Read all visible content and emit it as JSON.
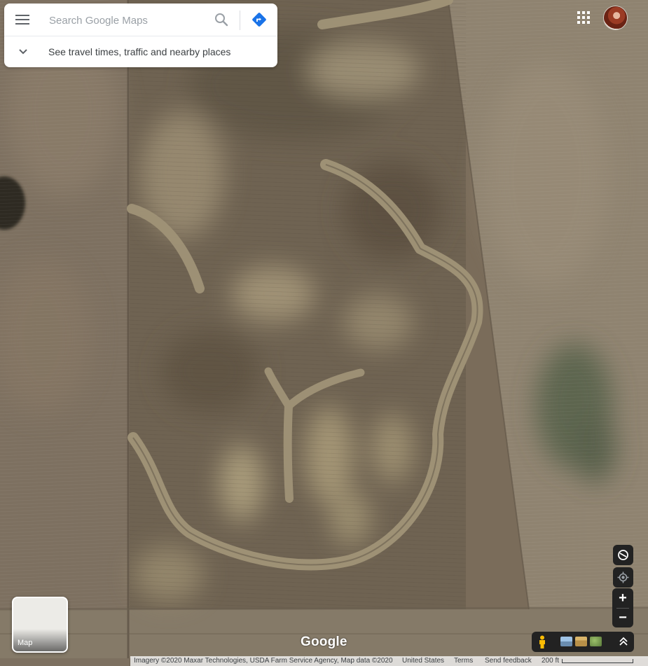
{
  "search": {
    "placeholder": "Search Google Maps"
  },
  "nearby": {
    "label": "See travel times, traffic and nearby places"
  },
  "icons": {
    "menu": "menu-icon",
    "search": "search-icon",
    "directions": "directions-icon",
    "chevron": "chevron-down-icon",
    "apps": "apps-grid-icon",
    "avatar": "account-avatar",
    "rotate": "rotate-view-icon",
    "location": "my-location-icon",
    "zoom_in": "plus-icon",
    "zoom_out": "minus-icon",
    "pegman": "street-view-pegman-icon",
    "expand": "expand-up-icon"
  },
  "layer_toggle": {
    "label": "Map"
  },
  "zoom": {
    "in_label": "+",
    "out_label": "−"
  },
  "branding": {
    "logo_text": "Google"
  },
  "footer": {
    "attribution": "Imagery ©2020 Maxar Technologies, USDA Farm Service Agency, Map data ©2020",
    "country": "United States",
    "terms": "Terms",
    "feedback": "Send feedback",
    "scale": "200 ft"
  },
  "colors": {
    "accent_blue": "#1a73e8",
    "field_base": "#7a6c5a",
    "control_dark": "#222222"
  }
}
